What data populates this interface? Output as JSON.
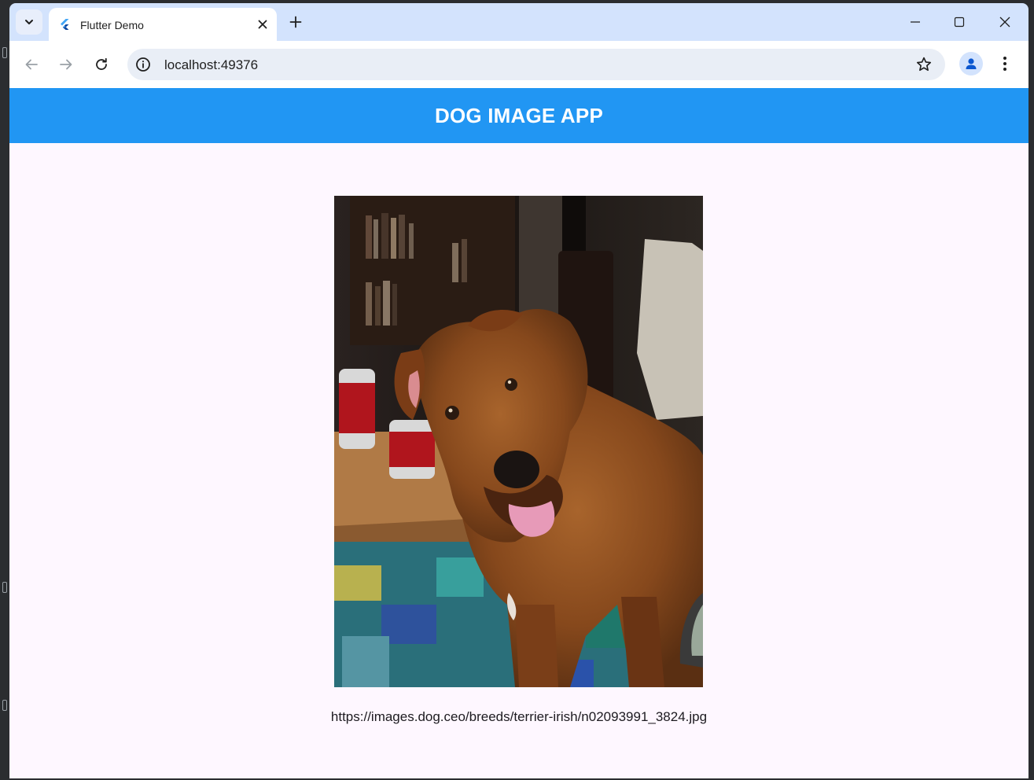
{
  "browser": {
    "tab": {
      "title": "Flutter Demo"
    },
    "address_bar": {
      "url": "localhost:49376"
    }
  },
  "app": {
    "title": "DOG IMAGE APP",
    "image_url": "https://images.dog.ceo/breeds/terrier-irish/n02093991_3824.jpg",
    "image_subject": "Irish terrier",
    "colors": {
      "appbar": "#2196f3",
      "background": "#fef7ff",
      "chrome": "#d3e3fd"
    }
  }
}
